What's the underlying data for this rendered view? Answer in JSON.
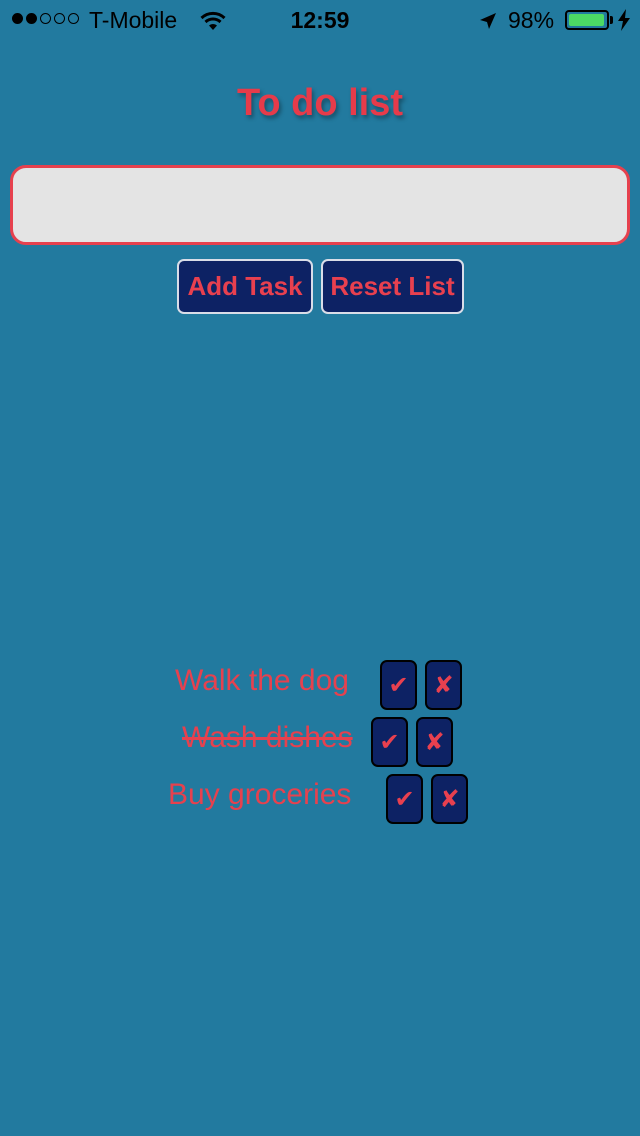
{
  "status_bar": {
    "carrier": "T-Mobile",
    "signal_bars_filled": 2,
    "signal_bars_total": 5,
    "time": "12:59",
    "battery_percent": "98%",
    "battery_level": 0.98,
    "icons": [
      "wifi-icon",
      "location-arrow-icon",
      "battery-icon",
      "charging-bolt-icon"
    ]
  },
  "app": {
    "title": "To do list",
    "input": {
      "value": "",
      "placeholder": ""
    },
    "buttons": {
      "add_label": "Add Task",
      "reset_label": "Reset List"
    },
    "tasks": [
      {
        "text": "Walk the dog",
        "completed": false,
        "check_symbol": "✔",
        "delete_symbol": "✘"
      },
      {
        "text": "Wash dishes",
        "completed": true,
        "check_symbol": "✔",
        "delete_symbol": "✘"
      },
      {
        "text": "Buy groceries",
        "completed": false,
        "check_symbol": "✔",
        "delete_symbol": "✘"
      }
    ]
  },
  "colors": {
    "background": "#227a9f",
    "accent_red": "#e6414e",
    "button_navy": "#0d2264",
    "input_bg": "#e4e4e4",
    "battery_green": "#4cd964"
  }
}
